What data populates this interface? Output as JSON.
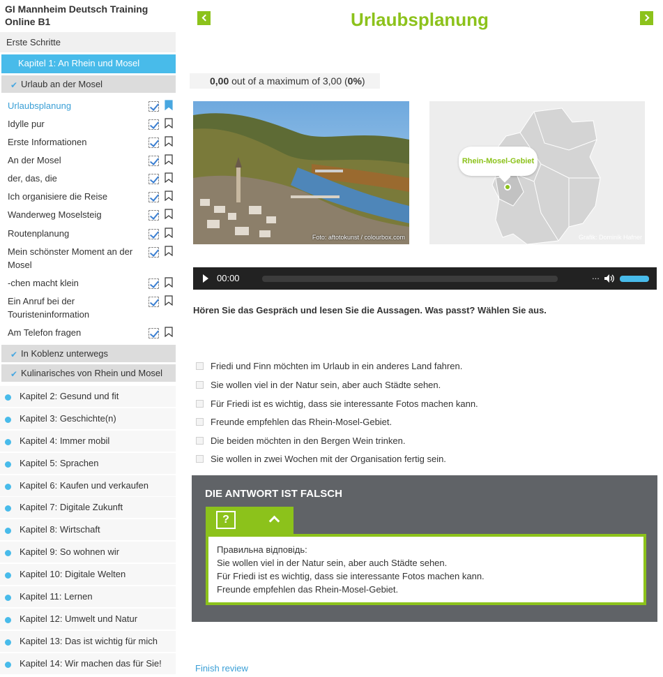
{
  "sidebar": {
    "course_title": "GI Mannheim Deutsch Training Online B1",
    "first_steps": "Erste Schritte",
    "current_chapter": "Kapitel 1: An Rhein und Mosel",
    "sections": [
      {
        "label": "Urlaub an der Mosel",
        "checked": true
      },
      {
        "label": "In Koblenz unterwegs",
        "checked": true
      },
      {
        "label": "Kulinarisches von Rhein und Mosel",
        "checked": true
      }
    ],
    "lessons": [
      {
        "label": "Urlaubsplanung",
        "active": true
      },
      {
        "label": "Idylle pur"
      },
      {
        "label": "Erste Informationen"
      },
      {
        "label": "An der Mosel"
      },
      {
        "label": "der, das, die"
      },
      {
        "label": "Ich organisiere die Reise"
      },
      {
        "label": "Wanderweg Moselsteig"
      },
      {
        "label": "Routenplanung"
      },
      {
        "label": "Mein schönster Moment an der Mosel"
      },
      {
        "label": "-chen macht klein"
      },
      {
        "label": "Ein Anruf bei der Touristeninformation"
      },
      {
        "label": "Am Telefon fragen"
      }
    ],
    "chapters": [
      "Kapitel 2: Gesund und fit",
      "Kapitel 3: Geschichte(n)",
      "Kapitel 4: Immer mobil",
      "Kapitel 5: Sprachen",
      "Kapitel 6: Kaufen und verkaufen",
      "Kapitel 7: Digitale Zukunft",
      "Kapitel 8: Wirtschaft",
      "Kapitel 9: So wohnen wir",
      "Kapitel 10: Digitale Welten",
      "Kapitel 11: Lernen",
      "Kapitel 12: Umwelt und Natur",
      "Kapitel 13: Das ist wichtig für mich",
      "Kapitel 14: Wir machen das für Sie!"
    ]
  },
  "main": {
    "title": "Urlaubsplanung",
    "score": {
      "value": "0,00",
      "text": "out of a maximum of",
      "max": "3,00",
      "percent": "0%"
    },
    "photo_credit": "Foto: aftotokunst / colourbox.com",
    "map_label": "Rhein-Mosel-Gebiet",
    "map_credit": "Grafik: Dominik Hafner",
    "audio": {
      "time": "00:00",
      "dots": "...",
      "volume_fraction": 1.0
    },
    "instruction": "Hören Sie das Gespräch und lesen Sie die Aussagen. Was passt? Wählen Sie aus.",
    "options": [
      "Friedi und Finn möchten im Urlaub in ein anderes Land fahren.",
      "Sie wollen viel in der Natur sein, aber auch Städte sehen.",
      "Für Friedi ist es wichtig, dass sie interessante Fotos machen kann.",
      "Freunde empfehlen das Rhein-Mosel-Gebiet.",
      "Die beiden möchten in den Bergen Wein trinken.",
      "Sie wollen in zwei Wochen mit der Organisation fertig sein."
    ],
    "feedback": {
      "title": "DIE ANTWORT IST FALSCH",
      "help_symbol": "?",
      "answer_lines": [
        "Правильна відповідь:",
        "Sie wollen viel in der Natur sein, aber auch Städte sehen.",
        "Für Friedi ist es wichtig, dass sie interessante Fotos machen kann.",
        "Freunde empfehlen das Rhein-Mosel-Gebiet."
      ]
    },
    "finish_review": "Finish review"
  },
  "colors": {
    "accent_green": "#8cc21b",
    "accent_blue": "#48bbea",
    "feedback_bg": "#606367"
  }
}
